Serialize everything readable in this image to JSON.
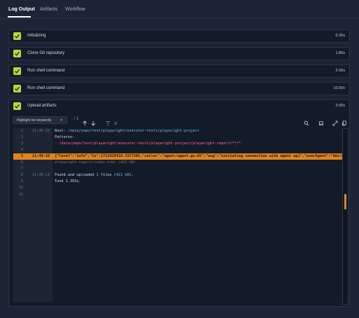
{
  "tabs": [
    {
      "label": "Log Output",
      "active": true
    },
    {
      "label": "Artifacts",
      "active": false
    },
    {
      "label": "Workflow",
      "active": false
    }
  ],
  "steps": [
    {
      "label": "Initializing",
      "duration": "0.20s",
      "status": "success"
    },
    {
      "label": "Clone Git repository",
      "duration": "1.80s",
      "status": "success"
    },
    {
      "label": "Run shell command",
      "duration": "2.00s",
      "status": "success"
    },
    {
      "label": "Run shell command",
      "duration": "10.00s",
      "status": "success"
    },
    {
      "label": "Upload artifacts",
      "duration": "2.00s",
      "status": "success"
    }
  ],
  "toolbar": {
    "keyword_select": "Highlight for keywords",
    "match_counter": "- / 1"
  },
  "log": [
    {
      "num": "1",
      "time": "11:40:10",
      "parts": [
        {
          "t": "Root: ",
          "c": ""
        },
        {
          "t": "/data/zepo/test/playwright/executor-tests/playwright-project",
          "c": "c-path"
        }
      ]
    },
    {
      "num": "2",
      "time": "",
      "parts": [
        {
          "t": "Patterns:",
          "c": ""
        }
      ]
    },
    {
      "num": "3",
      "time": "",
      "parts": [
        {
          "t": "- /data/zepo/test/playwright/executor-tests/playwright-project/playwright-report/**/*",
          "c": "c-pink"
        }
      ]
    },
    {
      "num": "4",
      "time": "",
      "parts": [
        {
          "t": "",
          "c": ""
        }
      ]
    },
    {
      "num": "5",
      "time": "11:40:10",
      "highlight": true,
      "parts": [
        {
          "t": "{\"level\":\"info\",\"ts\":1712828410.3377385,\"caller\":\"agent/agent.go:85\",\"msg\":\"initiating connection with agent api\",\"userAgent\":\"dev/none\",",
          "c": ""
        }
      ]
    },
    {
      "num": "6",
      "time": "",
      "parts": [
        {
          "t": "playwright-report/index.html (421 kB)",
          "c": "c-dim"
        }
      ]
    },
    {
      "num": "7",
      "time": "",
      "parts": [
        {
          "t": "",
          "c": ""
        }
      ]
    },
    {
      "num": "8",
      "time": "11:40:11",
      "parts": [
        {
          "t": "Found and uploaded ",
          "c": ""
        },
        {
          "t": "1",
          "c": "c-num"
        },
        {
          "t": " files (",
          "c": ""
        },
        {
          "t": "421 kB",
          "c": "c-num"
        },
        {
          "t": ").",
          "c": ""
        }
      ]
    },
    {
      "num": "9",
      "time": "",
      "parts": [
        {
          "t": "Took 1.355s.",
          "c": ""
        }
      ]
    },
    {
      "num": "10",
      "time": "",
      "parts": [
        {
          "t": "",
          "c": ""
        }
      ]
    },
    {
      "num": "11",
      "time": "",
      "parts": [
        {
          "t": "",
          "c": ""
        }
      ]
    }
  ],
  "colors": {
    "accent": "#e0841e",
    "success": "#b9d83a",
    "background": "#1c2435"
  },
  "icons": [
    "check-icon",
    "chevron-down-icon",
    "arrow-up-icon",
    "arrow-down-icon",
    "filter-icon",
    "search-icon",
    "copy-icon",
    "expand-icon",
    "clipboard-icon"
  ]
}
